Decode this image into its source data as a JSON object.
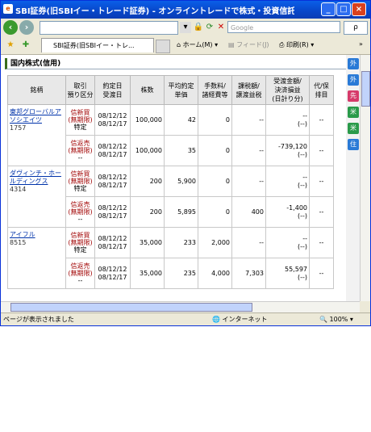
{
  "window": {
    "title": "SBI証券(旧SBIイー・トレード証券) - オンライントレードで株式・投資信託・債券を - - Win...",
    "icon": "ie-icon"
  },
  "toolbar": {
    "address_value": "",
    "search_placeholder": "Google",
    "search_go": "ρ"
  },
  "tabs": {
    "active_label": "SBI証券(旧SBIイー・トレ...",
    "home_label": "ホーム(M)",
    "feed_label": "フィード(J)",
    "print_label": "印刷(R)"
  },
  "section": {
    "title": "国内株式(信用)"
  },
  "table": {
    "headers": [
      "銘柄",
      "取引\n預り区分",
      "約定日\n受渡日",
      "株数",
      "平均約定\n単価",
      "手数料/\n諸経費等",
      "課税額/\n譲渡益税",
      "受渡金額/\n決済損益\n(日計り分)",
      "代/保\n排目"
    ],
    "rows": [
      {
        "stock_name": "東邦グローバルアソシエイツ",
        "stock_code": "1757",
        "type": "信新買",
        "term": "(無期限)",
        "account": "特定",
        "trade_date": "08/12/12",
        "settle_date": "08/12/17",
        "shares": "100,000",
        "price": "42",
        "fee": "0",
        "tax": "--",
        "amount": "--",
        "pl": "(--)",
        "extra": "--"
      },
      {
        "stock_name": "",
        "stock_code": "",
        "type": "信返売",
        "term": "(無期限)",
        "account": "--",
        "trade_date": "08/12/12",
        "settle_date": "08/12/17",
        "shares": "100,000",
        "price": "35",
        "fee": "0",
        "tax": "--",
        "amount": "-739,120",
        "pl": "(--)",
        "extra": "--"
      },
      {
        "stock_name": "ダヴィンチ・ホールディングス",
        "stock_code": "4314",
        "type": "信新買",
        "term": "(無期限)",
        "account": "特定",
        "trade_date": "08/12/12",
        "settle_date": "08/12/17",
        "shares": "200",
        "price": "5,900",
        "fee": "0",
        "tax": "--",
        "amount": "--",
        "pl": "(--)",
        "extra": "--"
      },
      {
        "stock_name": "",
        "stock_code": "",
        "type": "信返売",
        "term": "(無期限)",
        "account": "--",
        "trade_date": "08/12/12",
        "settle_date": "08/12/17",
        "shares": "200",
        "price": "5,895",
        "fee": "0",
        "tax": "400",
        "amount": "-1,400",
        "pl": "(--)",
        "extra": "--"
      },
      {
        "stock_name": "アイフル",
        "stock_code": "8515",
        "type": "信新買",
        "term": "(無期限)",
        "account": "特定",
        "trade_date": "08/12/12",
        "settle_date": "08/12/17",
        "shares": "35,000",
        "price": "233",
        "fee": "2,000",
        "tax": "--",
        "amount": "--",
        "pl": "(--)",
        "extra": "--"
      },
      {
        "stock_name": "",
        "stock_code": "",
        "type": "信返売",
        "term": "(無期限)",
        "account": "--",
        "trade_date": "08/12/12",
        "settle_date": "08/12/17",
        "shares": "35,000",
        "price": "235",
        "fee": "4,000",
        "tax": "7,303",
        "amount": "55,597",
        "pl": "(--)",
        "extra": "--"
      }
    ]
  },
  "right_panel": [
    "外",
    "外",
    "先",
    "米",
    "米",
    "住"
  ],
  "status": {
    "text": "ページが表示されました",
    "zone": "インターネット",
    "zoom": "100%"
  }
}
